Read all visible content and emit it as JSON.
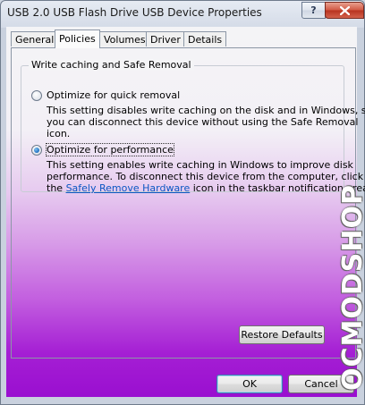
{
  "window": {
    "title": "USB 2.0 USB Flash Drive USB Device Properties"
  },
  "titlebar_buttons": {
    "help_icon": "question-mark-icon",
    "help_label": "?",
    "close_icon": "close-x-icon"
  },
  "tabs": [
    {
      "label": "General",
      "active": false
    },
    {
      "label": "Policies",
      "active": true
    },
    {
      "label": "Volumes",
      "active": false
    },
    {
      "label": "Driver",
      "active": false
    },
    {
      "label": "Details",
      "active": false
    }
  ],
  "group": {
    "title": "Write caching and Safe Removal"
  },
  "options": {
    "quick_removal": {
      "label": "Optimize for quick removal",
      "selected": false,
      "description": [
        "This setting disables write caching on the disk and in Windows, so",
        "you can disconnect this device without using the Safe Removal",
        "icon."
      ]
    },
    "performance": {
      "label": "Optimize for performance",
      "selected": true,
      "description_line1": "This setting enables write caching in Windows to improve disk",
      "description_line2": "performance. To disconnect this device from the computer, click",
      "description_pre_link": "the ",
      "link_text": "Safely Remove Hardware",
      "description_post_link": " icon in the taskbar notification area."
    }
  },
  "buttons": {
    "restore_defaults": "Restore Defaults",
    "ok": "OK",
    "cancel": "Cancel"
  },
  "watermark": {
    "text": "OCMODSHOP"
  },
  "colors": {
    "gradient_top": "#f4f4f6",
    "gradient_bottom": "#9a0fd0",
    "link": "#0b57c3",
    "radio_selected": "#1f6fc0"
  }
}
